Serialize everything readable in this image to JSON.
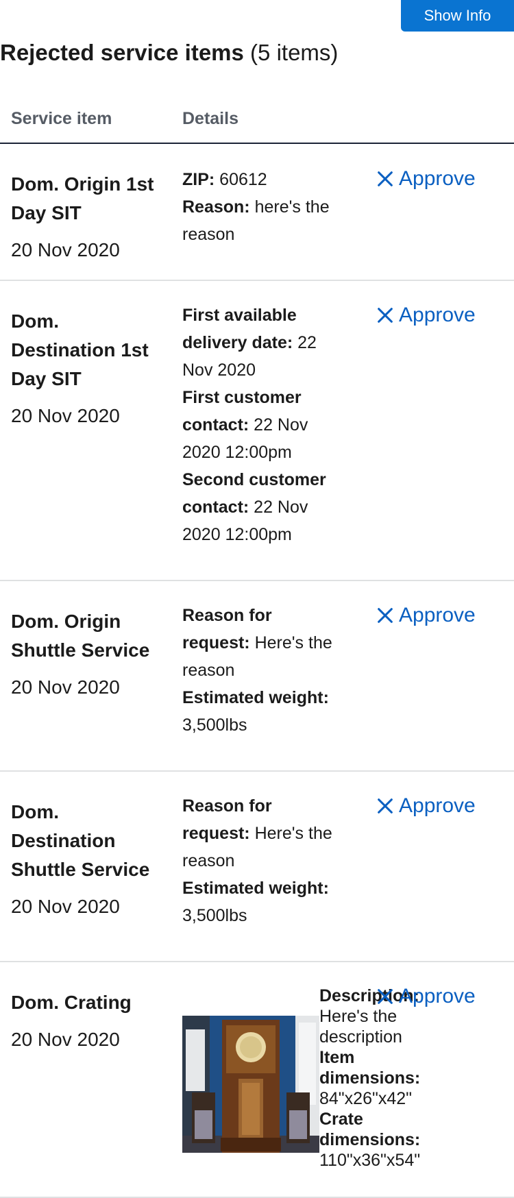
{
  "header": {
    "show_info_label": "Show Info",
    "title_strong": "Rejected service items",
    "title_count": " (5 items)"
  },
  "table": {
    "col_service": "Service item",
    "col_details": "Details"
  },
  "rows": [
    {
      "name": "Dom. Origin 1st Day SIT",
      "date": "20 Nov 2020",
      "action": "Approve",
      "details": [
        {
          "label": "ZIP:",
          "value": " 60612"
        },
        {
          "label": "Reason:",
          "value": " here's the reason"
        }
      ]
    },
    {
      "name": "Dom. Destination 1st Day SIT",
      "date": "20 Nov 2020",
      "action": "Approve",
      "details": [
        {
          "label": "First available delivery date:",
          "value": " 22 Nov 2020"
        },
        {
          "label": "First customer contact:",
          "value": " 22 Nov 2020 12:00pm"
        },
        {
          "label": "Second customer contact:",
          "value": " 22 Nov 2020 12:00pm"
        }
      ]
    },
    {
      "name": "Dom. Origin Shuttle Service",
      "date": "20 Nov 2020",
      "action": "Approve",
      "details": [
        {
          "label": "Reason for request:",
          "value": " Here's the reason"
        },
        {
          "label": "Estimated weight:",
          "value": " 3,500lbs"
        }
      ]
    },
    {
      "name": "Dom. Destination Shuttle Service",
      "date": "20 Nov 2020",
      "action": "Approve",
      "details": [
        {
          "label": "Reason for request:",
          "value": " Here's the reason"
        },
        {
          "label": "Estimated weight:",
          "value": " 3,500lbs"
        }
      ]
    },
    {
      "name": "Dom. Crating",
      "date": "20 Nov 2020",
      "action": "Approve",
      "image": "grandfather-clock-photo",
      "details": [
        {
          "label": "Description:",
          "value": " Here's the description"
        },
        {
          "label": "Item dimensions:",
          "value": " 84\"x26\"x42\""
        },
        {
          "label": "Crate dimensions:",
          "value": " 110\"x36\"x54\""
        }
      ]
    }
  ],
  "icons": {
    "action_icon": "close-icon",
    "accent": "#0a5fc1",
    "button_bg": "#0a74d1"
  }
}
